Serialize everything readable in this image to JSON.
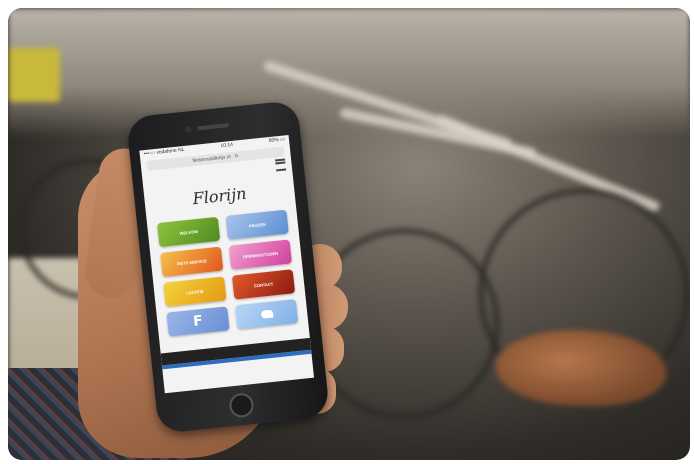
{
  "phone": {
    "status_carrier": "•••○○ vodafone NL",
    "status_time": "10:14",
    "status_battery": "80% ▭",
    "url": "fietsenstallorijn.nl",
    "reload_icon": "reload-icon",
    "logo_text": "Florijn",
    "tiles": [
      {
        "label": "Welkom",
        "color": "green"
      },
      {
        "label": "Prijzen",
        "color": "blue"
      },
      {
        "label": "Fiets service",
        "color": "orange"
      },
      {
        "label": "Openingstijden",
        "color": "pink"
      },
      {
        "label": "Locatie",
        "color": "yellow"
      },
      {
        "label": "Contact",
        "color": "red"
      },
      {
        "label": "facebook",
        "color": "fb"
      },
      {
        "label": "twitter",
        "color": "tw"
      }
    ]
  }
}
